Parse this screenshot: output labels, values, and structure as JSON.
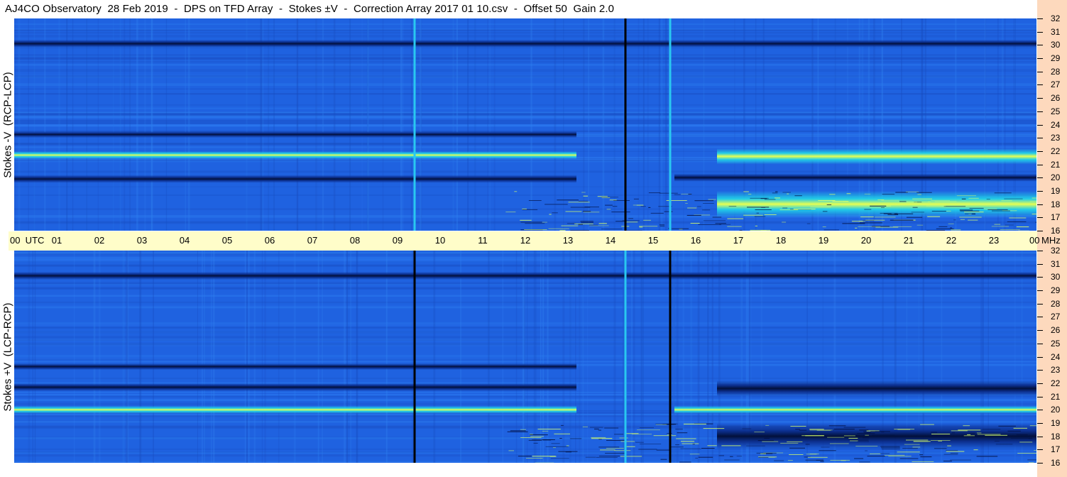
{
  "title": "AJ4CO Observatory  28 Feb 2019  -  DPS on TFD Array  -  Stokes ±V  -  Correction Array 2017 01 10.csv  -  Offset 50  Gain 2.0",
  "colors": {
    "background": "#1f62e0",
    "time_strip": "#fffdc9",
    "freq_strip": "#fdd9bd",
    "high_level": "#e8ff50",
    "low_level": "#02103a"
  },
  "chart_data": {
    "type": "heatmap",
    "title": "AJ4CO Observatory  28 Feb 2019  -  DPS on TFD Array  -  Stokes ±V  -  Correction Array 2017 01 10.csv  -  Offset 50  Gain 2.0",
    "time_axis": {
      "unit": "UTC",
      "labels": [
        "00  UTC",
        "01",
        "02",
        "03",
        "04",
        "05",
        "06",
        "07",
        "08",
        "09",
        "10",
        "11",
        "12",
        "13",
        "14",
        "15",
        "16",
        "17",
        "18",
        "19",
        "20",
        "21",
        "22",
        "23",
        "00"
      ],
      "hours": [
        0,
        1,
        2,
        3,
        4,
        5,
        6,
        7,
        8,
        9,
        10,
        11,
        12,
        13,
        14,
        15,
        16,
        17,
        18,
        19,
        20,
        21,
        22,
        23,
        24
      ],
      "range": [
        0,
        24
      ]
    },
    "freq_axis": {
      "unit": "MHz",
      "labels": [
        "16",
        "17",
        "18",
        "19",
        "20",
        "21",
        "22",
        "23",
        "24",
        "25",
        "26",
        "27",
        "28",
        "29",
        "30",
        "31",
        "32"
      ],
      "values": [
        16,
        17,
        18,
        19,
        20,
        21,
        22,
        23,
        24,
        25,
        26,
        27,
        28,
        29,
        30,
        31,
        32
      ],
      "range": [
        16,
        32
      ]
    },
    "panels": [
      {
        "ylabel": "Stokes -V  (RCP-LCP)",
        "bands": [
          {
            "f_lo": 19.6,
            "f_hi": 20.2,
            "t_from": 0,
            "t_to": 13.2,
            "level": "low"
          },
          {
            "f_lo": 21.4,
            "f_hi": 22.0,
            "t_from": 0,
            "t_to": 13.2,
            "level": "high"
          },
          {
            "f_lo": 23.0,
            "f_hi": 23.5,
            "t_from": 0,
            "t_to": 13.2,
            "level": "low"
          },
          {
            "f_lo": 29.8,
            "f_hi": 30.4,
            "t_from": 0,
            "t_to": 24,
            "level": "low"
          },
          {
            "f_lo": 19.7,
            "f_hi": 20.3,
            "t_from": 15.5,
            "t_to": 24,
            "level": "low"
          },
          {
            "f_lo": 21.0,
            "f_hi": 22.2,
            "t_from": 16.5,
            "t_to": 24,
            "level": "high"
          },
          {
            "f_lo": 17.0,
            "f_hi": 19.0,
            "t_from": 16.5,
            "t_to": 24,
            "level": "high"
          }
        ],
        "vertical_lines": [
          {
            "t": 9.4,
            "level": "high"
          },
          {
            "t": 14.35,
            "level": "low"
          },
          {
            "t": 15.4,
            "level": "high"
          }
        ]
      },
      {
        "ylabel": "Stokes +V  (LCP-RCP)",
        "bands": [
          {
            "f_lo": 19.7,
            "f_hi": 20.3,
            "t_from": 0,
            "t_to": 13.2,
            "level": "high"
          },
          {
            "f_lo": 21.4,
            "f_hi": 22.0,
            "t_from": 0,
            "t_to": 13.2,
            "level": "low"
          },
          {
            "f_lo": 23.0,
            "f_hi": 23.5,
            "t_from": 0,
            "t_to": 13.2,
            "level": "low"
          },
          {
            "f_lo": 29.8,
            "f_hi": 30.4,
            "t_from": 0,
            "t_to": 24,
            "level": "low"
          },
          {
            "f_lo": 19.7,
            "f_hi": 20.3,
            "t_from": 15.5,
            "t_to": 24,
            "level": "high"
          },
          {
            "f_lo": 21.0,
            "f_hi": 22.2,
            "t_from": 16.5,
            "t_to": 24,
            "level": "low"
          },
          {
            "f_lo": 17.0,
            "f_hi": 19.0,
            "t_from": 16.5,
            "t_to": 24,
            "level": "low"
          }
        ],
        "vertical_lines": [
          {
            "t": 9.4,
            "level": "low"
          },
          {
            "t": 14.35,
            "level": "high"
          },
          {
            "t": 15.4,
            "level": "low"
          }
        ]
      }
    ]
  }
}
